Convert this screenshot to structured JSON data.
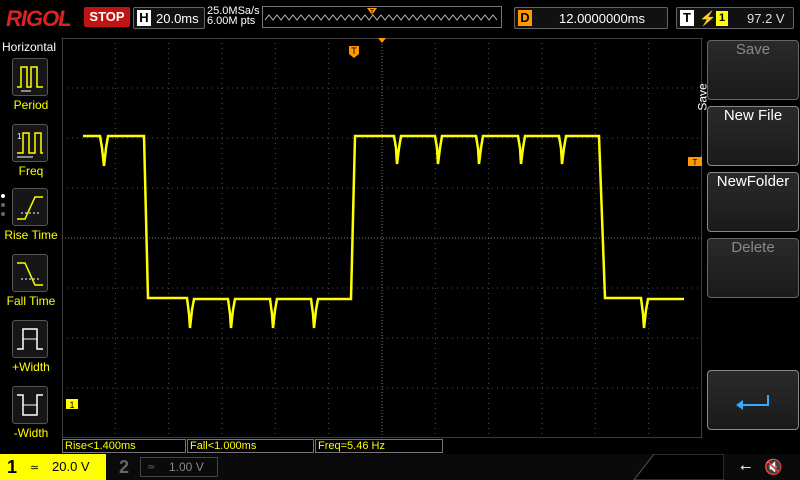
{
  "header": {
    "logo": "RIGOL",
    "run_state": "STOP",
    "timebase_letter": "H",
    "timebase": "20.0ms",
    "sample_rate": "25.0MSa/s",
    "memory_depth": "6.00M pts",
    "delay_letter": "D",
    "delay": "12.0000000ms",
    "trigger_letter": "T",
    "trigger_slope": "⚡",
    "trigger_source": "1",
    "trigger_level": "97.2 V"
  },
  "left_menu": {
    "title": "Horizontal",
    "items": [
      {
        "label": "Period",
        "icon": "period-icon"
      },
      {
        "label": "Freq",
        "icon": "frequency-icon"
      },
      {
        "label": "Rise Time",
        "icon": "rise-time-icon"
      },
      {
        "label": "Fall Time",
        "icon": "fall-time-icon"
      },
      {
        "label": "+Width",
        "icon": "positive-width-icon"
      },
      {
        "label": "-Width",
        "icon": "negative-width-icon"
      }
    ]
  },
  "markers": {
    "trigger_position": "T",
    "trigger_level": "T",
    "channel1_offset": "1"
  },
  "measurements": [
    {
      "text": "Rise<1.400ms"
    },
    {
      "text": "Fall<1.000ms"
    },
    {
      "text": "Freq=5.46 Hz"
    }
  ],
  "right_menu": {
    "title": "Save",
    "buttons": [
      {
        "label": "Save",
        "enabled": false
      },
      {
        "label": "New File",
        "enabled": true
      },
      {
        "label": "NewFolder",
        "enabled": true
      },
      {
        "label": "Delete",
        "enabled": false
      }
    ],
    "back_icon": "return-arrow-icon"
  },
  "channels": {
    "ch1": {
      "number": "1",
      "coupling": "≃",
      "scale": "20.0 V"
    },
    "ch2": {
      "number": "2",
      "coupling": "≃",
      "scale": "1.00 V"
    }
  },
  "status_icons": [
    "usb-icon",
    "mute-icon"
  ],
  "colors": {
    "trace": "#ffff00",
    "grid": "#555555",
    "marker": "#ff9900",
    "stop": "#c01414"
  }
}
